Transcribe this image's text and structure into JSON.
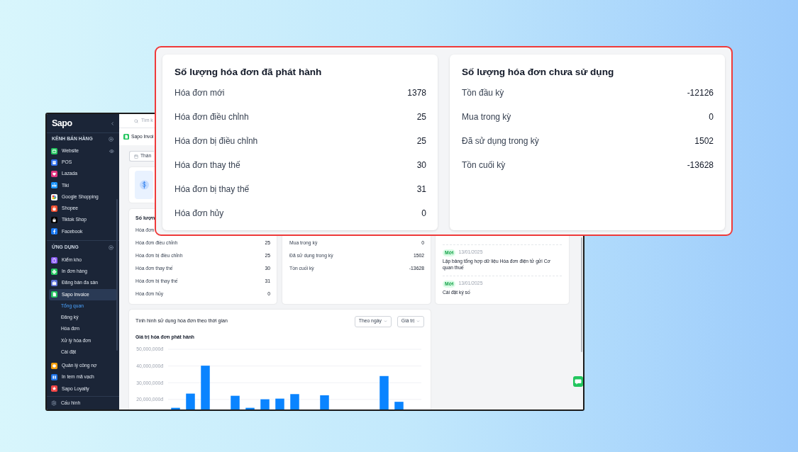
{
  "sidebar": {
    "logo": "Sapo",
    "sections": [
      {
        "title": "KÊNH BÁN HÀNG",
        "items": [
          {
            "label": "Website",
            "selected": false,
            "color": "#22c55e"
          },
          {
            "label": "POS",
            "selected": false,
            "color": "#2f6fed"
          },
          {
            "label": "Lazada",
            "selected": false,
            "color": "#e2347f"
          },
          {
            "label": "Tiki",
            "selected": false,
            "color": "#1a94ff"
          },
          {
            "label": "Google Shopping",
            "selected": false,
            "color": "#ffffff"
          },
          {
            "label": "Shopee",
            "selected": false,
            "color": "#ee4d2d"
          },
          {
            "label": "Tiktok Shop",
            "selected": false,
            "color": "#000000"
          },
          {
            "label": "Facebook",
            "selected": false,
            "color": "#1877f2"
          }
        ]
      },
      {
        "title": "ỨNG DỤNG",
        "items": [
          {
            "label": "Kiểm kho",
            "selected": false,
            "color": "#8b5cf6"
          },
          {
            "label": "In đơn hàng",
            "selected": false,
            "color": "#22c55e"
          },
          {
            "label": "Đăng bán đa sàn",
            "selected": false,
            "color": "#5b6fd6"
          },
          {
            "label": "Sapo Invoice",
            "selected": true,
            "color": "#22c55e",
            "children": [
              {
                "label": "Tổng quan",
                "selected": true
              },
              {
                "label": "Đăng ký",
                "selected": false
              },
              {
                "label": "Hóa đơn",
                "selected": false
              },
              {
                "label": "Xử lý hóa đơn",
                "selected": false
              },
              {
                "label": "Cài đặt",
                "selected": false
              }
            ]
          },
          {
            "label": "Quản lý công nợ",
            "selected": false,
            "color": "#f59e0b"
          },
          {
            "label": "In tem mã vạch",
            "selected": false,
            "color": "#1d72e8"
          },
          {
            "label": "Sapo Loyalty",
            "selected": false,
            "color": "#ef4444"
          }
        ]
      }
    ],
    "footer": {
      "label": "Cấu hình"
    }
  },
  "topbar": {
    "search": {
      "placeholder": "Tìm k"
    }
  },
  "breadcrumb": {
    "label": "Sapo Invoi"
  },
  "filter": {
    "label": "Thán"
  },
  "issued_card": {
    "title": "Số lượn",
    "rows": [
      {
        "label": "Hóa đơn"
      },
      {
        "label": "Hóa đơn điều chỉnh",
        "value": "25"
      },
      {
        "label": "Hóa đơn bị điều chỉnh",
        "value": "25"
      },
      {
        "label": "Hóa đơn thay thế",
        "value": "30"
      },
      {
        "label": "Hóa đơn bị thay thế",
        "value": "31"
      },
      {
        "label": "Hóa đơn hủy",
        "value": "0"
      }
    ]
  },
  "unused_card": {
    "rows": [
      {
        "label": "Mua trong kỳ",
        "value": "0"
      },
      {
        "label": "Đã sử dụng trong kỳ",
        "value": "1502"
      },
      {
        "label": "Tồn cuối kỳ",
        "value": "-13628"
      }
    ]
  },
  "news": {
    "items": [
      {
        "badge": "Mới",
        "date": "13/01/2025",
        "title": "Lập bảng tổng hợp dữ liệu Hóa đơn điện tử gửi Cơ quan thuế"
      },
      {
        "badge": "Mới",
        "date": "13/01/2025",
        "title": "Cài đặt ký số"
      }
    ]
  },
  "usage_chart": {
    "title": "Tình hình sử dụng hóa đơn theo thời gian",
    "dropdowns": [
      "Theo ngày",
      "Giá trị"
    ],
    "chart_data": {
      "type": "bar",
      "title": "Giá trị hóa đơn phát hành",
      "grid": true,
      "ylim": [
        14000000,
        50000000
      ],
      "yticks": [
        {
          "value": 20000000,
          "label": "20,000,000đ"
        },
        {
          "value": 30000000,
          "label": "30,000,000đ"
        },
        {
          "value": 40000000,
          "label": "40,000,000đ"
        },
        {
          "value": 50000000,
          "label": "50,000,000đ"
        }
      ],
      "values": [
        15000000,
        23500000,
        40200000,
        null,
        22200000,
        15000000,
        20100000,
        20500000,
        23200000,
        null,
        22500000,
        null,
        null,
        null,
        34000000,
        18600000,
        null
      ]
    }
  },
  "zoom_callout": {
    "cards": [
      {
        "title": "Số lượng hóa đơn đã phát hành",
        "rows": [
          {
            "label": "Hóa đơn mới",
            "value": "1378"
          },
          {
            "label": "Hóa đơn điều chỉnh",
            "value": "25"
          },
          {
            "label": "Hóa đơn bị điều chỉnh",
            "value": "25"
          },
          {
            "label": "Hóa đơn thay thế",
            "value": "30"
          },
          {
            "label": "Hóa đơn bị thay thế",
            "value": "31"
          },
          {
            "label": "Hóa đơn hủy",
            "value": "0"
          }
        ]
      },
      {
        "title": "Số lượng hóa đơn chưa sử dụng",
        "rows": [
          {
            "label": "Tồn đầu kỳ",
            "value": "-12126"
          },
          {
            "label": "Mua trong kỳ",
            "value": "0"
          },
          {
            "label": "Đã sử dụng trong kỳ",
            "value": "1502"
          },
          {
            "label": "Tồn cuối kỳ",
            "value": "-13628"
          }
        ]
      }
    ]
  }
}
